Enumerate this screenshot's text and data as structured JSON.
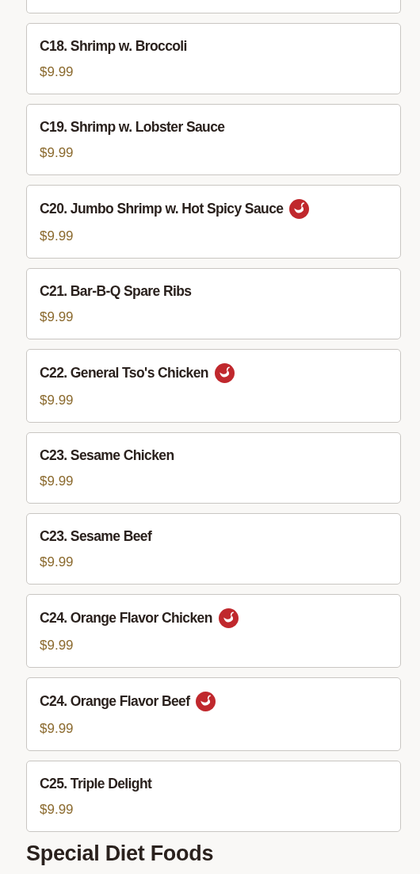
{
  "items": [
    {
      "name": "C18. Shrimp w. Broccoli",
      "price": "$9.99",
      "spicy": false
    },
    {
      "name": "C19. Shrimp w. Lobster Sauce",
      "price": "$9.99",
      "spicy": false
    },
    {
      "name": "C20. Jumbo Shrimp w. Hot Spicy Sauce",
      "price": "$9.99",
      "spicy": true
    },
    {
      "name": "C21. Bar-B-Q Spare Ribs",
      "price": "$9.99",
      "spicy": false
    },
    {
      "name": "C22. General Tso's Chicken",
      "price": "$9.99",
      "spicy": true
    },
    {
      "name": "C23. Sesame Chicken",
      "price": "$9.99",
      "spicy": false
    },
    {
      "name": "C23. Sesame Beef",
      "price": "$9.99",
      "spicy": false
    },
    {
      "name": "C24. Orange Flavor Chicken",
      "price": "$9.99",
      "spicy": true
    },
    {
      "name": "C24. Orange Flavor Beef",
      "price": "$9.99",
      "spicy": true
    },
    {
      "name": "C25. Triple Delight",
      "price": "$9.99",
      "spicy": false
    }
  ],
  "next_section": {
    "title": "Special Diet Foods"
  }
}
